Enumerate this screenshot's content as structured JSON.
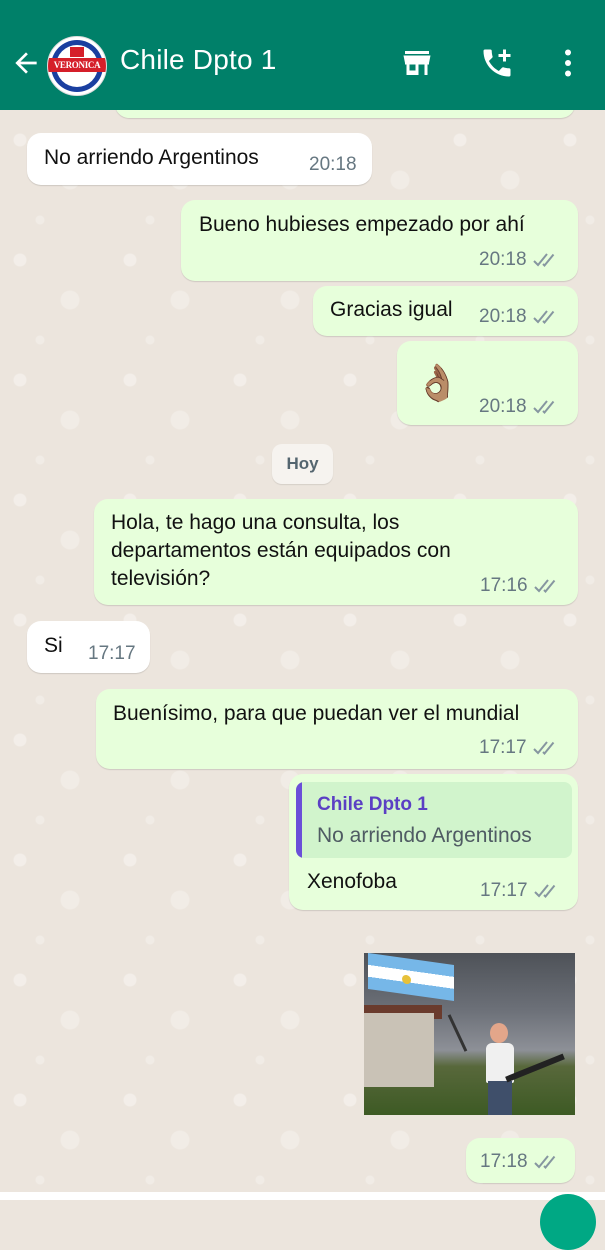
{
  "header": {
    "title": "Chile Dpto 1",
    "avatar_label": "VERONICA",
    "avatar_sub": "PROPIEDADES",
    "bg_color": "#008069"
  },
  "messages": [
    {
      "id": 1,
      "direction": "in",
      "text": "No arriendo Argentinos",
      "time": "20:18"
    },
    {
      "id": 2,
      "direction": "out",
      "text": "Bueno hubieses empezado por ahí",
      "time": "20:18",
      "status": "read"
    },
    {
      "id": 3,
      "direction": "out",
      "text": "Gracias igual",
      "time": "20:18",
      "status": "read"
    },
    {
      "id": 4,
      "direction": "out",
      "text": "👌🏽",
      "time": "20:18",
      "status": "read"
    },
    {
      "id": 5,
      "direction": "out",
      "text_lines": [
        "Hola, te hago una consulta, los",
        "departamentos están equipados con",
        "televisión?"
      ],
      "time": "17:16",
      "status": "read"
    },
    {
      "id": 6,
      "direction": "in",
      "text": "Si",
      "time": "17:17"
    },
    {
      "id": 7,
      "direction": "out",
      "text": "Buenísimo, para que puedan ver el mundial",
      "time": "17:17",
      "status": "read"
    },
    {
      "id": 8,
      "direction": "out",
      "quote_name": "Chile Dpto 1",
      "quote_text": "No arriendo Argentinos",
      "text": "Xenofoba",
      "time": "17:17",
      "status": "read"
    },
    {
      "id": 9,
      "direction": "out",
      "type": "image",
      "time": "17:18",
      "status": "read"
    }
  ],
  "date_separator": "Hoy",
  "icons": [
    "back-arrow-icon",
    "store-icon",
    "add-call-icon",
    "more-vert-icon",
    "double-check-icon"
  ],
  "colors": {
    "incoming": "#ffffff",
    "outgoing": "#e7ffdb",
    "ticks": "#8696a0",
    "quote_accent": "#6b4fd8"
  }
}
